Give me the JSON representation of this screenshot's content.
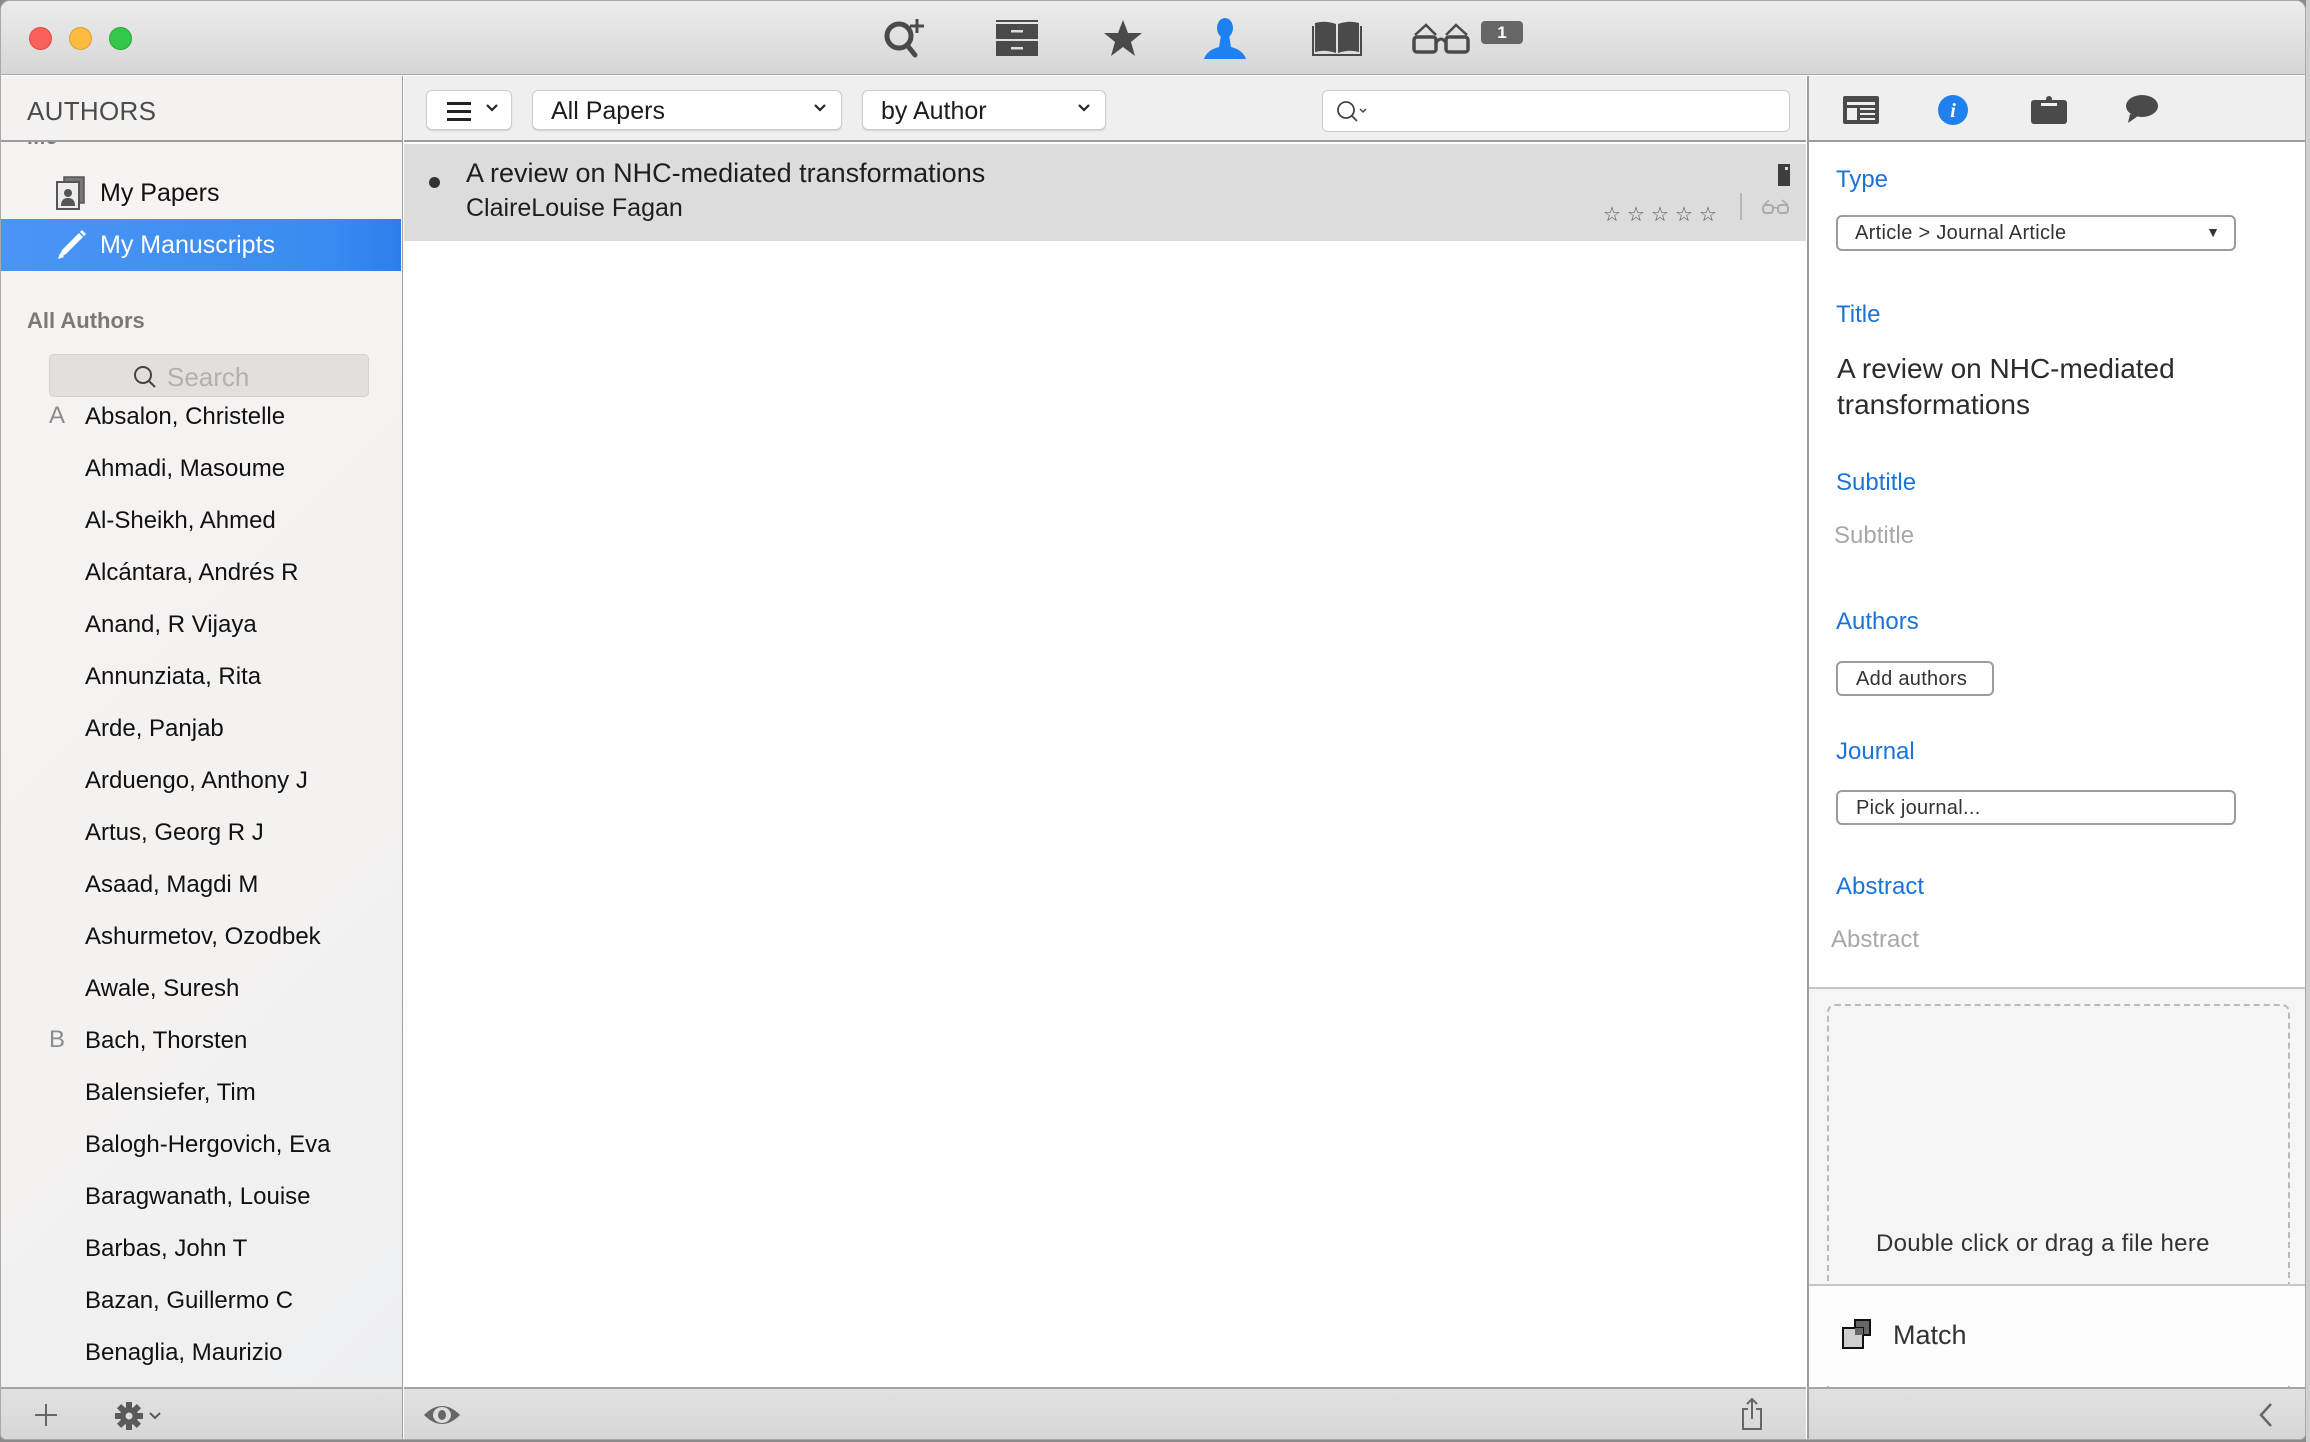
{
  "toolbar": {
    "icons": [
      "search-add-icon",
      "cabinet-icon",
      "star-icon",
      "person-icon",
      "book-icon",
      "glasses-icon"
    ],
    "active_icon": "person-icon",
    "reading_list_count": "1"
  },
  "colors": {
    "accent": "#2f87ee",
    "label_blue": "#1a73d9",
    "selection": "#3a8cf0"
  },
  "sidebar": {
    "header": "AUTHORS",
    "me_section": "Me",
    "items": [
      {
        "label": "My Papers",
        "icon": "my-papers-icon",
        "selected": false
      },
      {
        "label": "My Manuscripts",
        "icon": "pencil-icon",
        "selected": true
      }
    ],
    "all_authors_title": "All Authors",
    "search_placeholder": "Search",
    "authors": [
      {
        "letter": "A",
        "name": "Absalon, Christelle"
      },
      {
        "letter": "",
        "name": "Ahmadi, Masoume"
      },
      {
        "letter": "",
        "name": "Al-Sheikh, Ahmed"
      },
      {
        "letter": "",
        "name": "Alcántara, Andrés R"
      },
      {
        "letter": "",
        "name": "Anand, R Vijaya"
      },
      {
        "letter": "",
        "name": "Annunziata, Rita"
      },
      {
        "letter": "",
        "name": "Arde, Panjab"
      },
      {
        "letter": "",
        "name": "Arduengo, Anthony J"
      },
      {
        "letter": "",
        "name": "Artus, Georg R J"
      },
      {
        "letter": "",
        "name": "Asaad, Magdi M"
      },
      {
        "letter": "",
        "name": "Ashurmetov, Ozodbek"
      },
      {
        "letter": "",
        "name": "Awale, Suresh"
      },
      {
        "letter": "B",
        "name": "Bach, Thorsten"
      },
      {
        "letter": "",
        "name": "Balensiefer, Tim"
      },
      {
        "letter": "",
        "name": "Balogh-Hergovich, Eva"
      },
      {
        "letter": "",
        "name": "Baragwanath, Louise"
      },
      {
        "letter": "",
        "name": "Barbas, John T"
      },
      {
        "letter": "",
        "name": "Bazan, Guillermo C"
      },
      {
        "letter": "",
        "name": "Benaglia, Maurizio"
      }
    ]
  },
  "middle": {
    "filter_select": "All Papers",
    "sort_select": "by Author",
    "search_value": "",
    "papers": [
      {
        "title": "A review on NHC-mediated transformations",
        "author": "ClaireLouise Fagan",
        "rating": 0,
        "max_rating": 5,
        "unread": true
      }
    ]
  },
  "inspector": {
    "tabs": [
      "layout-icon",
      "info-icon",
      "briefcase-icon",
      "comment-icon"
    ],
    "active_tab": "info-icon",
    "type_label": "Type",
    "type_value": "Article > Journal Article",
    "title_label": "Title",
    "title_value": "A review on NHC-mediated transformations",
    "subtitle_label": "Subtitle",
    "subtitle_placeholder": "Subtitle",
    "authors_label": "Authors",
    "add_authors_button": "Add authors",
    "journal_label": "Journal",
    "pick_journal_button": "Pick journal...",
    "abstract_label": "Abstract",
    "abstract_placeholder": "Abstract",
    "drop_text": "Double click or drag a file here",
    "match_label": "Match"
  }
}
